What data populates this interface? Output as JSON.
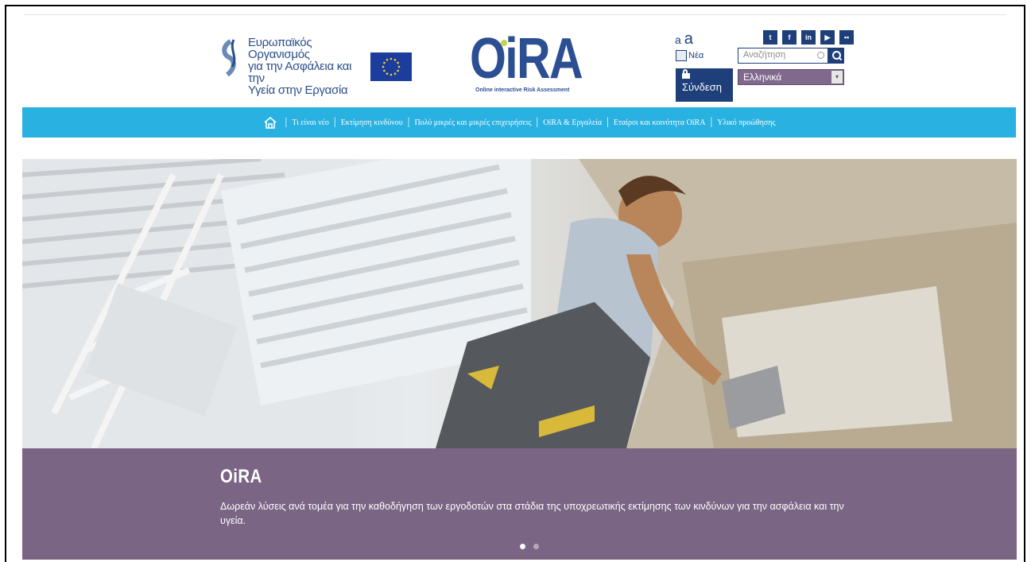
{
  "header": {
    "agency_name": [
      "Ευρωπαϊκός Οργανισμός",
      "για την Ασφάλεια και την",
      "Υγεία στην Εργασία"
    ],
    "oira_logo_text": "OiRA",
    "oira_tagline": "Online interactive Risk Assessment",
    "font_size_small": "a",
    "font_size_large": "a",
    "news_label": "Νέα",
    "login_label": "Σύνδεση",
    "search_placeholder": "Αναζήτηση",
    "language_selected": "Ελληνικά",
    "social": [
      "twitter-icon",
      "facebook-icon",
      "linkedin-icon",
      "youtube-icon",
      "flickr-icon"
    ]
  },
  "nav": {
    "items": [
      "Τι είναι νέο",
      "Εκτίμηση κινδύνου",
      "Πολύ μικρές και μικρές επιχειρήσεις",
      "OiRA & Εργαλεία",
      "Εταίροι και κοινότητα OiRA",
      "Υλικό προώθησης"
    ]
  },
  "hero": {
    "title": "OiRA",
    "text": "Δωρεάν λύσεις ανά τομέα για την καθοδήγηση των εργοδοτών στα στάδια της υποχρεωτικής εκτίμησης των κινδύνων για την ασφάλεια και την υγεία.",
    "slide_count": 2,
    "active_slide": 1
  },
  "colors": {
    "nav_bg": "#29b1e1",
    "brand_blue": "#1f3f7a",
    "caption_bg": "#7a6584"
  }
}
